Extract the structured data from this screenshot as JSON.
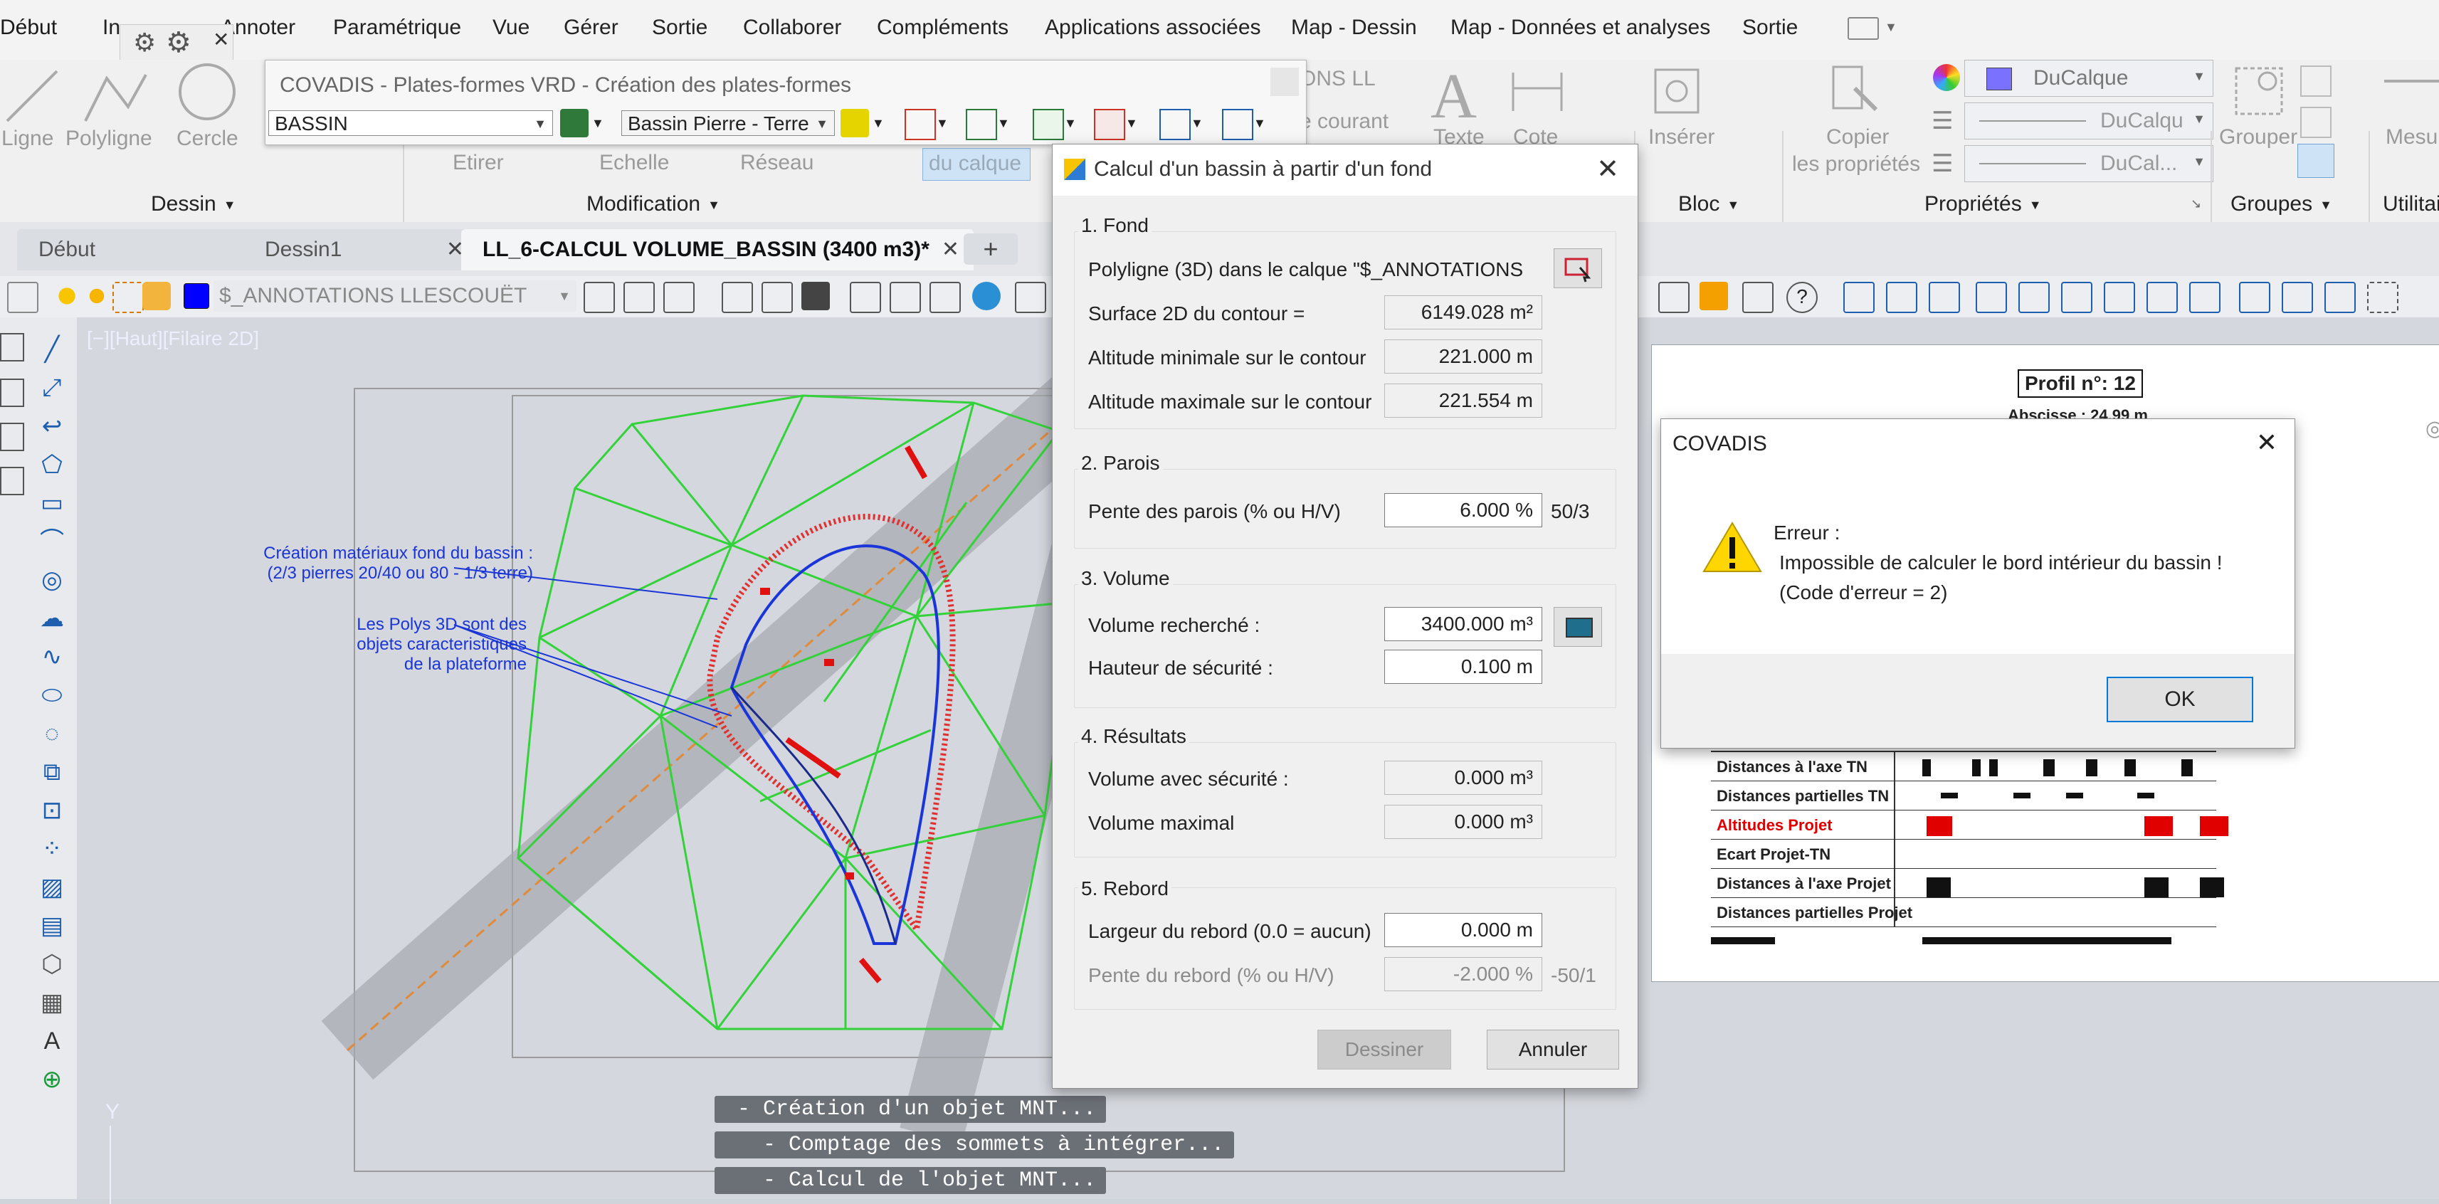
{
  "menubar": {
    "items": [
      "Début",
      "In",
      "Annoter",
      "Paramétrique",
      "Vue",
      "Gérer",
      "Sortie",
      "Collaborer",
      "Compléments",
      "Applications associées",
      "Map - Dessin",
      "Map - Données et analyses",
      "Sortie"
    ]
  },
  "ribbon": {
    "draw_tools": [
      "Ligne",
      "Polyligne",
      "Cercle"
    ],
    "modify_tools": [
      "Etirer",
      "Echelle",
      "Réseau"
    ],
    "layer_label": "du calque",
    "text_tools": [
      "Texte",
      "Cote"
    ],
    "insert_label": "Insérer",
    "copy_props": [
      "Copier",
      "les propriétés"
    ],
    "group_label": "Grouper",
    "measure_label": "Mesurer",
    "panels": [
      "Dessin",
      "Modification",
      "Bloc",
      "Propriétés",
      "Groupes",
      "Utilitaires"
    ],
    "bylayer": [
      "DuCalque",
      "DuCalqu",
      "DuCal..."
    ],
    "faded": [
      "ONS LL",
      "e courant"
    ]
  },
  "doc_tabs": [
    {
      "label": "Début"
    },
    {
      "label": "Dessin1",
      "close": "✕"
    },
    {
      "label": "LL_6-CALCUL VOLUME_BASSIN (3400 m3)*",
      "close": "✕"
    }
  ],
  "new_tab": "+",
  "layer_combo": "$_ANNOTATIONS LLESCOUËT",
  "viewport_label": "[−][Haut][Filaire 2D]",
  "covadis_bar": {
    "title": "COVADIS - Plates-formes VRD - Création des plates-formes",
    "combo1": "BASSIN",
    "combo2": "Bassin Pierre - Terre"
  },
  "annotations": {
    "a1_l1": "Création matériaux fond du bassin :",
    "a1_l2": "(2/3 pierres 20/40 ou 80 - 1/3 terre)",
    "a2_l1": "Les Polys 3D sont des",
    "a2_l2": "objets caracteristiques",
    "a2_l3": "de la plateforme"
  },
  "dialog": {
    "title": "Calcul d'un bassin à partir d'un fond",
    "close": "✕",
    "fond": {
      "title": "1. Fond",
      "poly_label": "Polyligne (3D) dans le calque \"$_ANNOTATIONS",
      "surface_label": "Surface 2D du contour =",
      "surface_value": "6149.028 m²",
      "alt_min_label": "Altitude minimale sur le contour",
      "alt_min_value": "221.000 m",
      "alt_max_label": "Altitude maximale sur le contour",
      "alt_max_value": "221.554 m"
    },
    "parois": {
      "title": "2. Parois",
      "pente_label": "Pente des parois (% ou H/V)",
      "pente_value": "6.000 %",
      "pente_ratio": "50/3"
    },
    "volume": {
      "title": "3. Volume",
      "vol_label": "Volume recherché :",
      "vol_value": "3400.000 m³",
      "haut_label": "Hauteur de sécurité :",
      "haut_value": "0.100 m"
    },
    "resultats": {
      "title": "4. Résultats",
      "vsec_label": "Volume avec sécurité :",
      "vsec_value": "0.000 m³",
      "vmax_label": "Volume maximal",
      "vmax_value": "0.000 m³"
    },
    "rebord": {
      "title": "5. Rebord",
      "larg_label": "Largeur du rebord (0.0 = aucun)",
      "larg_value": "0.000 m",
      "pente_label": "Pente du rebord (% ou H/V)",
      "pente_value": "-2.000 %",
      "pente_ratio": "-50/1"
    },
    "buttons": {
      "draw": "Dessiner",
      "cancel": "Annuler"
    }
  },
  "error": {
    "title": "COVADIS",
    "close": "✕",
    "line1": "Erreur :",
    "line2": "Impossible de calculer le bord intérieur du bassin !",
    "line3": "(Code d'erreur = 2)",
    "ok": "OK"
  },
  "profile": {
    "title": "Profil n°: 12",
    "abscisse": "Abscisse : 24.99 m",
    "rows": [
      "Distances à l'axe TN",
      "Distances partielles TN",
      "Altitudes Projet",
      "Ecart Projet-TN",
      "Distances à l'axe Projet",
      "Distances partielles Projet"
    ],
    "highlight_color": "#e00000"
  },
  "command_lines": [
    " - Création d'un objet MNT...",
    "   - Comptage des sommets à intégrer...",
    "   - Calcul de l'objet MNT..."
  ],
  "axis_y": "Y"
}
